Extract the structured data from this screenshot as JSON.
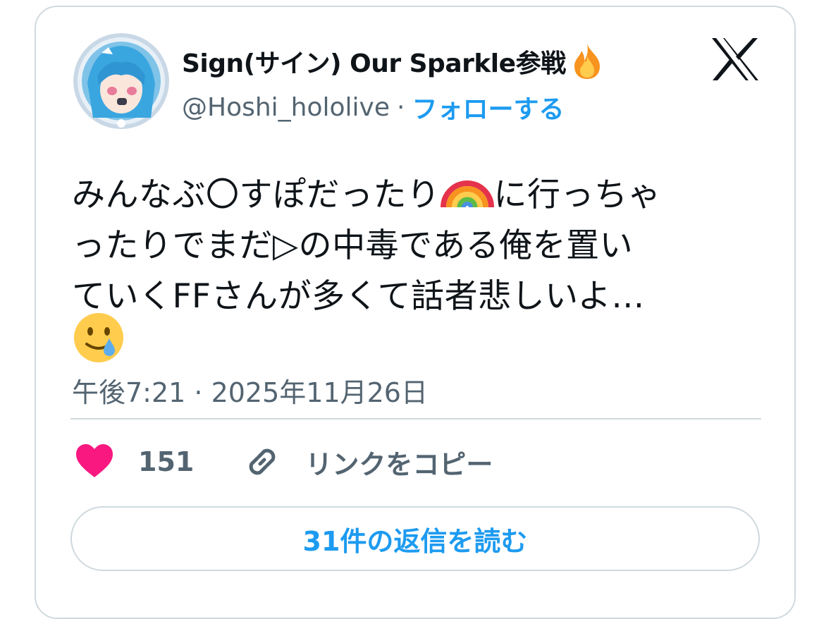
{
  "user": {
    "display_name": "Sign(サイン) Our Sparkle参戦",
    "name_emoji": "fire-emoji",
    "handle": "@Hoshi_hololive",
    "separator": "·",
    "follow_label": "フォローする",
    "avatar": "anime-character-avatar"
  },
  "brand": {
    "logo": "x-logo-icon"
  },
  "tweet": {
    "text_line1a": "みんなぶ〇すぽだったり",
    "text_line1b": "に行っちゃ",
    "text_line2": "ったりでまだ▷の中毒である俺を置い",
    "text_line3": "ていくFFさんが多くて話者悲しいよ…",
    "inline_emoji_1": "rainbow-emoji",
    "inline_emoji_2": "smiling-face-with-tear-emoji",
    "timestamp": "午後7:21 · 2025年11月26日"
  },
  "actions": {
    "like_count": "151",
    "copy_link_label": "リンクをコピー"
  },
  "replies_button": {
    "label": "31件の返信を読む"
  },
  "colors": {
    "accent": "#1d9bf0",
    "heart": "#f91880",
    "muted": "#536471",
    "border": "#cfd9de"
  }
}
